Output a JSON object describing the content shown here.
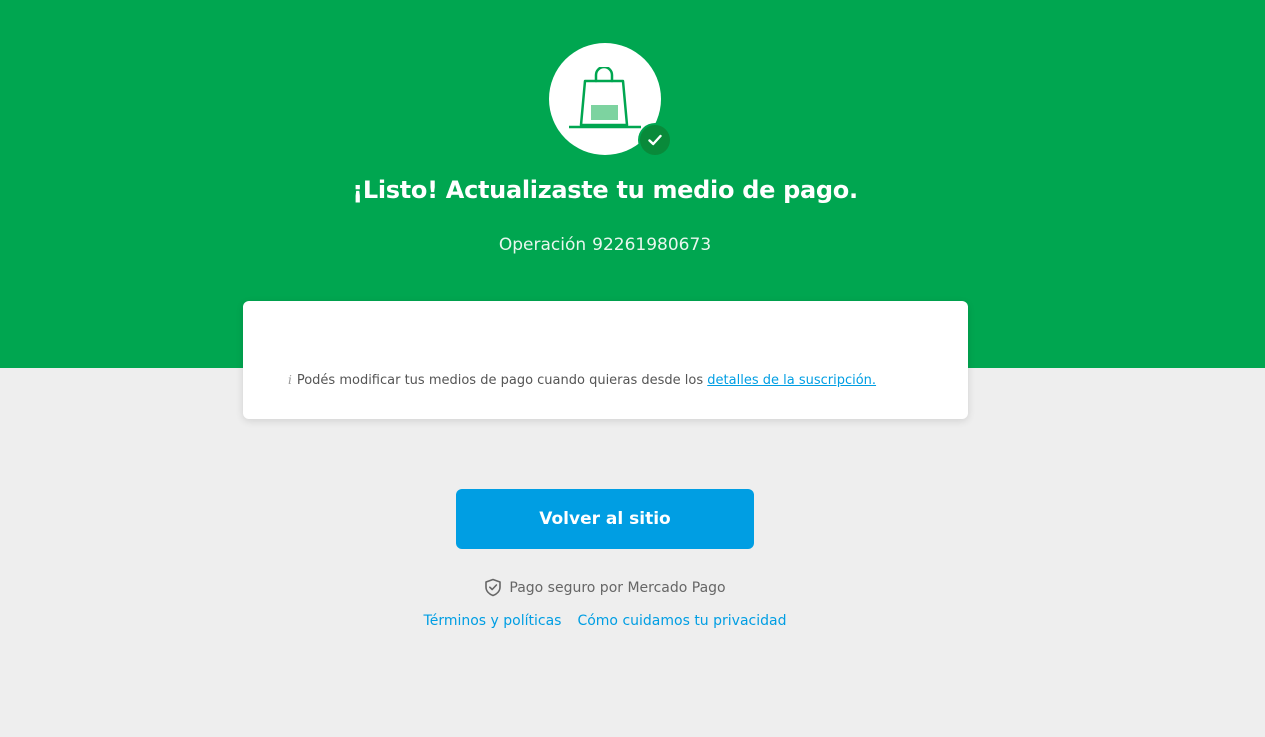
{
  "hero": {
    "title": "¡Listo! Actualizaste tu medio de pago.",
    "operation_label": "Operación",
    "operation_number": "92261980673",
    "icon": "shopping-bag-icon",
    "badge_icon": "check-icon"
  },
  "card": {
    "info_icon": "info-icon",
    "info_text": "Podés modificar tus medios de pago cuando quieras desde los ",
    "info_link": "detalles de la suscripción."
  },
  "actions": {
    "back_button_label": "Volver al sitio"
  },
  "footer": {
    "secure_icon": "shield-check-icon",
    "secure_text": "Pago seguro por Mercado Pago",
    "links": [
      "Términos y políticas",
      "Cómo cuidamos tu privacidad"
    ]
  },
  "colors": {
    "hero_green": "#00a650",
    "badge_green": "#098a3a",
    "link_blue": "#009ee3",
    "background": "#eeeeee"
  }
}
